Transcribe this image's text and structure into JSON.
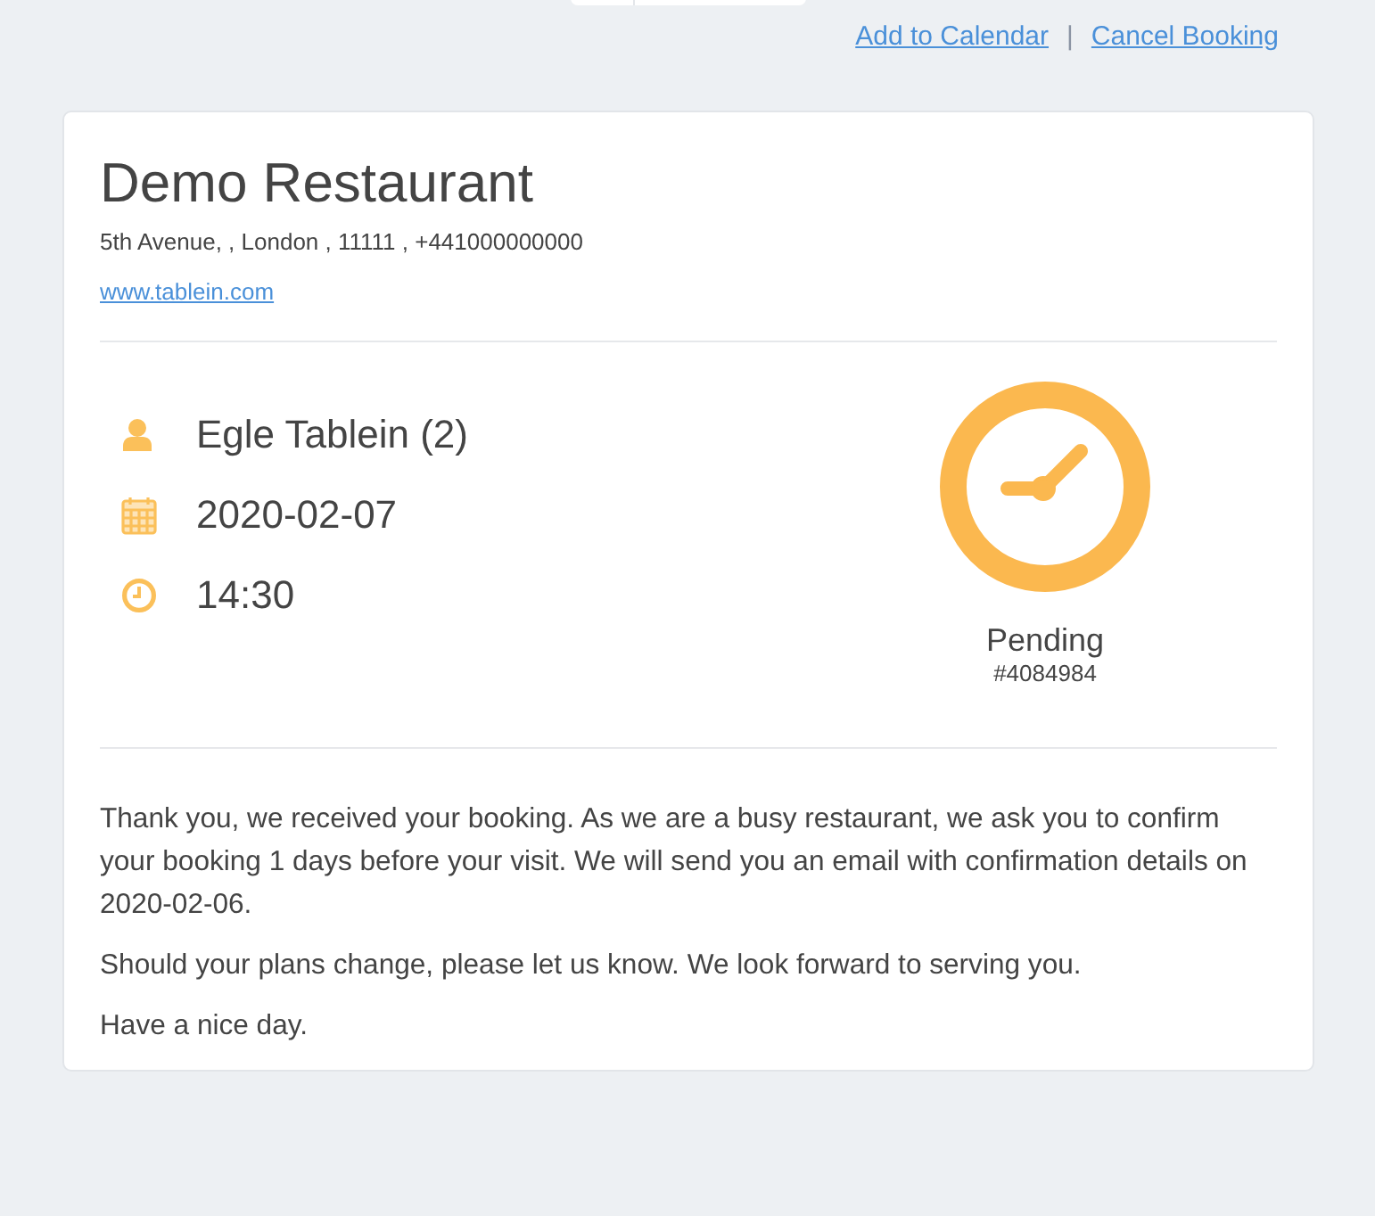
{
  "top_links": [
    {
      "label": "Add to Calendar"
    },
    {
      "label": "Cancel Booking"
    }
  ],
  "link_separator": "|",
  "restaurant": {
    "name": "Demo Restaurant",
    "address": "5th Avenue, , London , 11111 , +441000000000",
    "website": "www.tablein.com"
  },
  "details": [
    {
      "kind": "guest",
      "text": "Egle Tablein (2)"
    },
    {
      "kind": "date",
      "text": "2020-02-07"
    },
    {
      "kind": "time",
      "text": "14:30"
    }
  ],
  "status": {
    "kind": "pending",
    "label": "Pending",
    "reference": "#4084984"
  },
  "message": [
    "Thank you, we received your booking. As we are a busy restaurant, we ask you to confirm your booking 1 days before your visit. We will send you an email with confirmation details on 2020-02-06.",
    "Should your plans change, please let us know. We look forward to serving you.",
    "Have a nice day."
  ]
}
